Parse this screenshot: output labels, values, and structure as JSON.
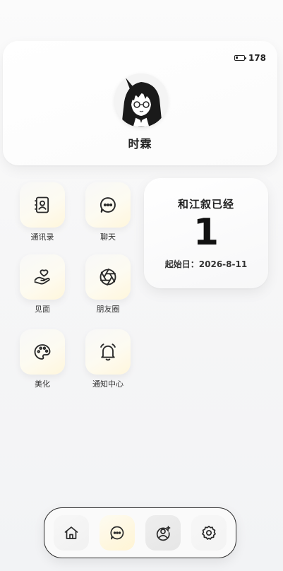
{
  "profile": {
    "name": "时霖",
    "battery": "178"
  },
  "apps": [
    {
      "label": "通讯录",
      "icon": "contacts-icon"
    },
    {
      "label": "聊天",
      "icon": "chat-icon"
    },
    {
      "label": "见面",
      "icon": "meet-icon"
    },
    {
      "label": "朋友圈",
      "icon": "moments-icon"
    },
    {
      "label": "美化",
      "icon": "palette-icon"
    },
    {
      "label": "通知中心",
      "icon": "bell-icon"
    }
  ],
  "counter": {
    "title": "和江叙已经",
    "days": "1",
    "start": "起始日：2026-8-11"
  },
  "dock": {
    "items": [
      "home-icon",
      "chat-icon",
      "user-profile-icon",
      "settings-icon"
    ],
    "active": "chat-icon"
  },
  "colors": {
    "tile_accent": "#fff6dc",
    "text": "#222222",
    "dock_border": "#2b2b2b"
  }
}
